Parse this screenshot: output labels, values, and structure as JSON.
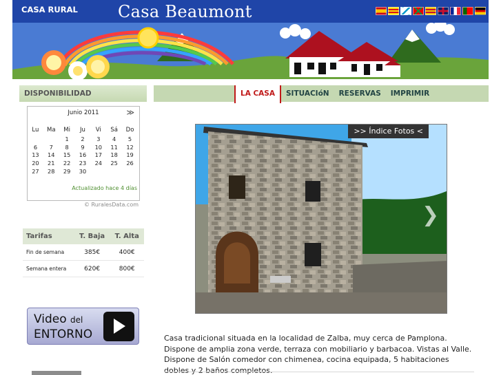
{
  "header": {
    "site_tag": "CASA RURAL",
    "title": "Casa Beaumont",
    "languages": [
      {
        "icon": "flag-es",
        "color": "#c60b1e"
      },
      {
        "icon": "flag-ca",
        "color": "#fcdd09"
      },
      {
        "icon": "flag-gl",
        "color": "#0099cc"
      },
      {
        "icon": "flag-eu",
        "color": "#e60000"
      },
      {
        "icon": "flag-ca2",
        "color": "#f2c300"
      },
      {
        "icon": "flag-uk",
        "color": "#012169"
      },
      {
        "icon": "flag-fr",
        "color": "#002395"
      },
      {
        "icon": "flag-pt",
        "color": "#006600"
      },
      {
        "icon": "flag-de",
        "color": "#dd0000"
      }
    ]
  },
  "availability": {
    "heading": "DISPONIBILIDAD",
    "month": "Junio 2011",
    "next": "≫",
    "weekdays": [
      "Lu",
      "Ma",
      "Mi",
      "Ju",
      "Vi",
      "Sá",
      "Do"
    ],
    "weeks": [
      [
        "",
        "",
        "1",
        "2",
        "3",
        "4",
        "5"
      ],
      [
        "6",
        "7",
        "8",
        "9",
        "10",
        "11",
        "12"
      ],
      [
        "13",
        "14",
        "15",
        "16",
        "17",
        "18",
        "19"
      ],
      [
        "20",
        "21",
        "22",
        "23",
        "24",
        "25",
        "26"
      ],
      [
        "27",
        "28",
        "29",
        "30",
        "",
        "",
        ""
      ]
    ],
    "updated": "Actualizado hace 4 días",
    "credit": "© RuralesData.com"
  },
  "rates": {
    "headers": [
      "Tarifas",
      "T. Baja",
      "T. Alta"
    ],
    "rows": [
      {
        "name": "Fin de semana",
        "low": "385€",
        "high": "400€"
      },
      {
        "name": "Semana entera",
        "low": "620€",
        "high": "800€"
      }
    ]
  },
  "video": {
    "line1": "Video",
    "line1_small": "del",
    "line2": "ENTORNO"
  },
  "nav": {
    "items": [
      {
        "label": "LA CASA",
        "active": true
      },
      {
        "label": "SITUACIóN",
        "active": false
      },
      {
        "label": "RESERVAS",
        "active": false
      },
      {
        "label": "IMPRIMIR",
        "active": false
      }
    ]
  },
  "photo": {
    "link": ">> Índice Fotos <",
    "arrow": "❯"
  },
  "description": "Casa tradicional situada en la localidad de Zalba, muy cerca de Pamplona. Dispone de amplia zona verde, terraza con mobiliario y barbacoa. Vistas al Valle. Dispone de Salón comedor con chimenea, cocina equipada, 5 habitaciones dobles y 2 baños completos."
}
